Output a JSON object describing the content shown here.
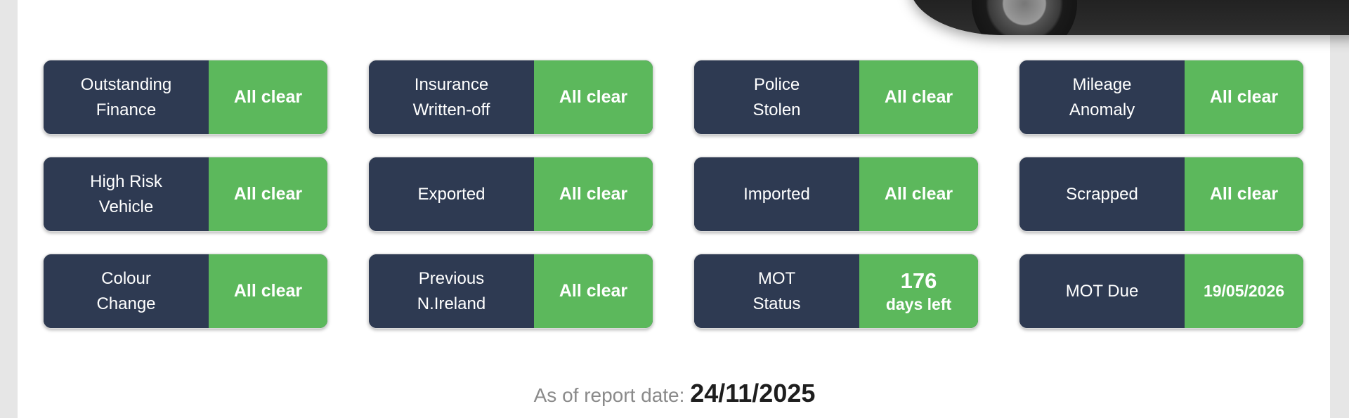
{
  "report": {
    "prefix": "As of report date: ",
    "date": "24/11/2025"
  },
  "colors": {
    "label_bg": "#2e3a52",
    "status_ok": "#5cb85c",
    "page_bg": "#ffffff"
  },
  "checks": [
    {
      "label_1": "Outstanding",
      "label_2": "Finance",
      "status": "All clear"
    },
    {
      "label_1": "Insurance",
      "label_2": "Written-off",
      "status": "All clear"
    },
    {
      "label_1": "Police",
      "label_2": "Stolen",
      "status": "All clear"
    },
    {
      "label_1": "Mileage",
      "label_2": "Anomaly",
      "status": "All clear"
    },
    {
      "label_1": "High Risk",
      "label_2": "Vehicle",
      "status": "All clear"
    },
    {
      "label_1": "Exported",
      "status": "All clear"
    },
    {
      "label_1": "Imported",
      "status": "All clear"
    },
    {
      "label_1": "Scrapped",
      "status": "All clear"
    },
    {
      "label_1": "Colour",
      "label_2": "Change",
      "status": "All clear"
    },
    {
      "label_1": "Previous",
      "label_2": "N.Ireland",
      "status": "All clear"
    },
    {
      "label_1": "MOT",
      "label_2": "Status",
      "status_number": "176",
      "status_unit": "days left"
    },
    {
      "label_1": "MOT Due",
      "status": "19/05/2026"
    }
  ]
}
